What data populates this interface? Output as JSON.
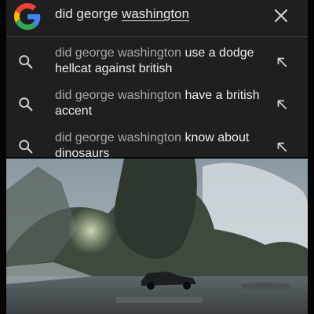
{
  "search": {
    "query_prefix": "did george ",
    "query_underlined": "washington"
  },
  "suggestions": [
    {
      "prefix": "did george washington ",
      "completion": "use a dodge hellcat against british"
    },
    {
      "prefix": "did george washington ",
      "completion": "have a british accent"
    },
    {
      "prefix": "did george washington ",
      "completion": "know about dinosaurs"
    }
  ],
  "icons": {
    "logo": "google-g-logo",
    "clear": "close-icon",
    "suggestion": "search-icon",
    "fill": "arrow-up-left-icon"
  },
  "colors": {
    "panel_bg": "#1f1f1f",
    "query_text": "#e8e8e8",
    "suggestion_dim": "#a9a9a9",
    "suggestion_bold": "#ededed",
    "google_blue": "#4285F4",
    "google_red": "#EA4335",
    "google_yellow": "#FBBC05",
    "google_green": "#34A853"
  }
}
